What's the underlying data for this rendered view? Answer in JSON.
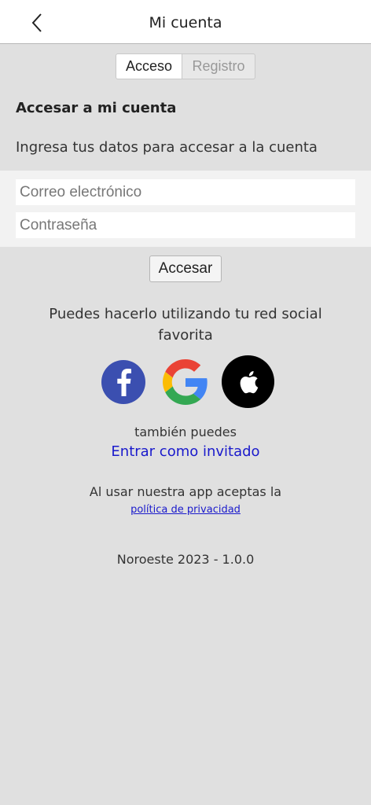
{
  "header": {
    "title": "Mi cuenta",
    "back_icon": "chevron-left-icon"
  },
  "tabs": [
    {
      "label": "Acceso",
      "active": true
    },
    {
      "label": "Registro",
      "active": false
    }
  ],
  "login": {
    "heading": "Accesar a mi cuenta",
    "subtitle": "Ingresa tus datos para accesar a la cuenta",
    "email_placeholder": "Correo electrónico",
    "password_placeholder": "Contraseña",
    "email_value": "",
    "password_value": "",
    "submit_label": "Accesar"
  },
  "social": {
    "text": "Puedes hacerlo utilizando tu red social favorita",
    "providers": [
      {
        "name": "facebook",
        "icon": "facebook-icon",
        "color": "#3b4fb0"
      },
      {
        "name": "google",
        "icon": "google-icon",
        "colors": [
          "#ea4335",
          "#fbbc05",
          "#34a853",
          "#4285f4"
        ]
      },
      {
        "name": "apple",
        "icon": "apple-icon",
        "color": "#000000"
      }
    ]
  },
  "guest": {
    "prefix": "también puedes",
    "link": "Entrar como invitado"
  },
  "terms": {
    "text": "Al usar nuestra app aceptas la",
    "link": "política de privacidad"
  },
  "footer": {
    "version": "Noroeste 2023 - 1.0.0"
  },
  "colors": {
    "background": "#e0e0e0",
    "link": "#1a1acc"
  }
}
